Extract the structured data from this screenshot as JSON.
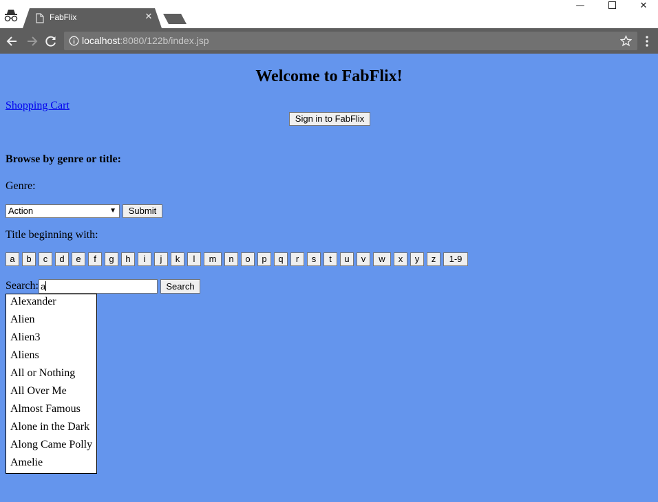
{
  "browser": {
    "tab_title": "FabFlix",
    "url_host": "localhost",
    "url_rest": ":8080/122b/index.jsp"
  },
  "page": {
    "title": "Welcome to FabFlix!",
    "cart_link": "Shopping Cart",
    "signin_button": "Sign in to FabFlix",
    "browse_heading": "Browse by genre or title:",
    "genre_label": "Genre:",
    "genre_selected": "Action",
    "submit_button": "Submit",
    "title_label": "Title beginning with:",
    "letters": [
      "a",
      "b",
      "c",
      "d",
      "e",
      "f",
      "g",
      "h",
      "i",
      "j",
      "k",
      "l",
      "m",
      "n",
      "o",
      "p",
      "q",
      "r",
      "s",
      "t",
      "u",
      "v",
      "w",
      "x",
      "y",
      "z",
      "1-9"
    ],
    "search_label": "Search:",
    "search_value": "a",
    "search_button": "Search",
    "suggestions": [
      "Alexander",
      "Alien",
      "Alien3",
      "Aliens",
      "All or Nothing",
      "All Over Me",
      "Almost Famous",
      "Alone in the Dark",
      "Along Came Polly",
      "Amelie"
    ]
  },
  "colors": {
    "page_background": "#6495ed",
    "chrome_dark": "#5e5e5e",
    "link": "#0000ee"
  }
}
